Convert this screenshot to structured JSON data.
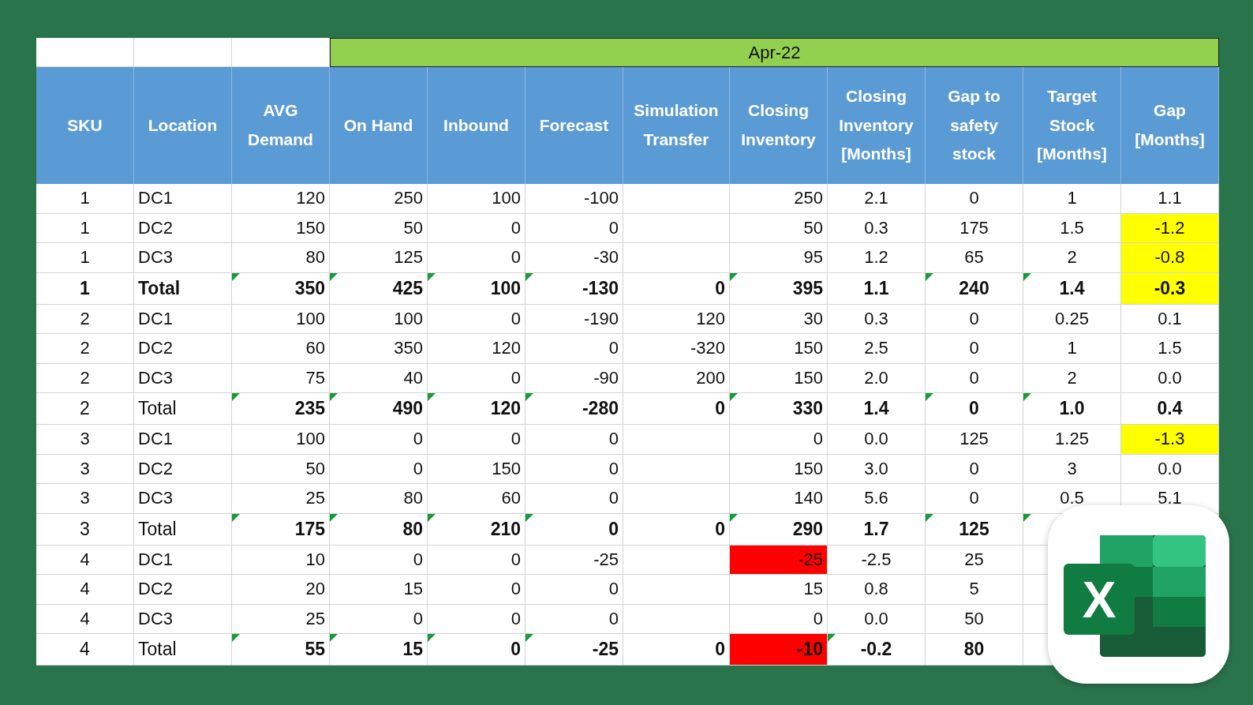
{
  "period": {
    "label": "Apr-22"
  },
  "columns": [
    "SKU",
    "Location",
    "AVG Demand",
    "On Hand",
    "Inbound",
    "Forecast",
    "Simulation Transfer",
    "Closing Inventory",
    "Closing Inventory [Months]",
    "Gap to safety stock",
    "Target Stock [Months]",
    "Gap [Months]"
  ],
  "rows": [
    {
      "kind": "detail",
      "label_bold": false,
      "cells": [
        {
          "text": "1"
        },
        {
          "text": "DC1"
        },
        {
          "text": "120"
        },
        {
          "text": "250"
        },
        {
          "text": "100"
        },
        {
          "text": "-100"
        },
        {},
        {
          "text": "250"
        },
        {
          "text": "2.1"
        },
        {
          "text": "0"
        },
        {
          "text": "1"
        },
        {
          "text": "1.1"
        }
      ]
    },
    {
      "kind": "detail",
      "label_bold": false,
      "cells": [
        {
          "text": "1"
        },
        {
          "text": "DC2"
        },
        {
          "text": "150"
        },
        {
          "text": "50"
        },
        {
          "text": "0"
        },
        {
          "text": "0"
        },
        {},
        {
          "text": "50"
        },
        {
          "text": "0.3"
        },
        {
          "text": "175"
        },
        {
          "text": "1.5"
        },
        {
          "text": "-1.2",
          "color": "#ffff00"
        }
      ]
    },
    {
      "kind": "detail",
      "label_bold": false,
      "cells": [
        {
          "text": "1"
        },
        {
          "text": "DC3"
        },
        {
          "text": "80"
        },
        {
          "text": "125"
        },
        {
          "text": "0"
        },
        {
          "text": "-30"
        },
        {},
        {
          "text": "95"
        },
        {
          "text": "1.2"
        },
        {
          "text": "65"
        },
        {
          "text": "2"
        },
        {
          "text": "-0.8",
          "color": "#ffff00"
        }
      ]
    },
    {
      "kind": "total",
      "label_bold": true,
      "cells": [
        {
          "text": "1",
          "flag": false
        },
        {
          "text": "Total",
          "flag": false
        },
        {
          "text": "350",
          "flag": true
        },
        {
          "text": "425",
          "flag": true
        },
        {
          "text": "100",
          "flag": true
        },
        {
          "text": "-130",
          "flag": true
        },
        {
          "text": "0",
          "flag": false
        },
        {
          "text": "395",
          "flag": true
        },
        {
          "text": "1.1",
          "flag": false
        },
        {
          "text": "240",
          "flag": true
        },
        {
          "text": "1.4",
          "flag": true
        },
        {
          "text": "-0.3",
          "flag": false,
          "color": "#ffff00"
        }
      ]
    },
    {
      "kind": "detail",
      "label_bold": false,
      "cells": [
        {
          "text": "2"
        },
        {
          "text": "DC1"
        },
        {
          "text": "100"
        },
        {
          "text": "100"
        },
        {
          "text": "0"
        },
        {
          "text": "-190"
        },
        {
          "text": "120"
        },
        {
          "text": "30"
        },
        {
          "text": "0.3"
        },
        {
          "text": "0"
        },
        {
          "text": "0.25"
        },
        {
          "text": "0.1"
        }
      ]
    },
    {
      "kind": "detail",
      "label_bold": false,
      "cells": [
        {
          "text": "2"
        },
        {
          "text": "DC2"
        },
        {
          "text": "60"
        },
        {
          "text": "350"
        },
        {
          "text": "120"
        },
        {
          "text": "0"
        },
        {
          "text": "-320"
        },
        {
          "text": "150"
        },
        {
          "text": "2.5"
        },
        {
          "text": "0"
        },
        {
          "text": "1"
        },
        {
          "text": "1.5"
        }
      ]
    },
    {
      "kind": "detail",
      "label_bold": false,
      "cells": [
        {
          "text": "2"
        },
        {
          "text": "DC3"
        },
        {
          "text": "75"
        },
        {
          "text": "40"
        },
        {
          "text": "0"
        },
        {
          "text": "-90"
        },
        {
          "text": "200"
        },
        {
          "text": "150"
        },
        {
          "text": "2.0"
        },
        {
          "text": "0"
        },
        {
          "text": "2"
        },
        {
          "text": "0.0"
        }
      ]
    },
    {
      "kind": "total",
      "label_bold": false,
      "cells": [
        {
          "text": "2",
          "flag": false
        },
        {
          "text": "Total",
          "flag": false
        },
        {
          "text": "235",
          "flag": true
        },
        {
          "text": "490",
          "flag": true
        },
        {
          "text": "120",
          "flag": true
        },
        {
          "text": "-280",
          "flag": true
        },
        {
          "text": "0",
          "flag": false
        },
        {
          "text": "330",
          "flag": true
        },
        {
          "text": "1.4",
          "flag": false
        },
        {
          "text": "0",
          "flag": true
        },
        {
          "text": "1.0",
          "flag": true
        },
        {
          "text": "0.4",
          "flag": false
        }
      ]
    },
    {
      "kind": "detail",
      "label_bold": false,
      "cells": [
        {
          "text": "3"
        },
        {
          "text": "DC1"
        },
        {
          "text": "100"
        },
        {
          "text": "0"
        },
        {
          "text": "0"
        },
        {
          "text": "0"
        },
        {},
        {
          "text": "0"
        },
        {
          "text": "0.0"
        },
        {
          "text": "125"
        },
        {
          "text": "1.25"
        },
        {
          "text": "-1.3",
          "color": "#ffff00"
        }
      ]
    },
    {
      "kind": "detail",
      "label_bold": false,
      "cells": [
        {
          "text": "3"
        },
        {
          "text": "DC2"
        },
        {
          "text": "50"
        },
        {
          "text": "0"
        },
        {
          "text": "150"
        },
        {
          "text": "0"
        },
        {},
        {
          "text": "150"
        },
        {
          "text": "3.0"
        },
        {
          "text": "0"
        },
        {
          "text": "3"
        },
        {
          "text": "0.0"
        }
      ]
    },
    {
      "kind": "detail",
      "label_bold": false,
      "cells": [
        {
          "text": "3"
        },
        {
          "text": "DC3"
        },
        {
          "text": "25"
        },
        {
          "text": "80"
        },
        {
          "text": "60"
        },
        {
          "text": "0"
        },
        {},
        {
          "text": "140"
        },
        {
          "text": "5.6"
        },
        {
          "text": "0"
        },
        {
          "text": "0.5"
        },
        {
          "text": "5.1"
        }
      ]
    },
    {
      "kind": "total",
      "label_bold": false,
      "cells": [
        {
          "text": "3",
          "flag": false
        },
        {
          "text": "Total",
          "flag": false
        },
        {
          "text": "175",
          "flag": true
        },
        {
          "text": "80",
          "flag": true
        },
        {
          "text": "210",
          "flag": true
        },
        {
          "text": "0",
          "flag": true
        },
        {
          "text": "0",
          "flag": false
        },
        {
          "text": "290",
          "flag": true
        },
        {
          "text": "1.7",
          "flag": false
        },
        {
          "text": "125",
          "flag": true
        },
        {
          "flag": true
        }
      ]
    },
    {
      "kind": "detail",
      "label_bold": false,
      "cells": [
        {
          "text": "4"
        },
        {
          "text": "DC1"
        },
        {
          "text": "10"
        },
        {
          "text": "0"
        },
        {
          "text": "0"
        },
        {
          "text": "-25"
        },
        {},
        {
          "text": "-25",
          "color": "#ff0000"
        },
        {
          "text": "-2.5"
        },
        {
          "text": "25"
        }
      ]
    },
    {
      "kind": "detail",
      "label_bold": false,
      "cells": [
        {
          "text": "4"
        },
        {
          "text": "DC2"
        },
        {
          "text": "20"
        },
        {
          "text": "15"
        },
        {
          "text": "0"
        },
        {
          "text": "0"
        },
        {},
        {
          "text": "15"
        },
        {
          "text": "0.8"
        },
        {
          "text": "5"
        }
      ]
    },
    {
      "kind": "detail",
      "label_bold": false,
      "cells": [
        {
          "text": "4"
        },
        {
          "text": "DC3"
        },
        {
          "text": "25"
        },
        {
          "text": "0"
        },
        {
          "text": "0"
        },
        {
          "text": "0"
        },
        {},
        {
          "text": "0"
        },
        {
          "text": "0.0"
        },
        {
          "text": "50"
        }
      ]
    },
    {
      "kind": "total",
      "label_bold": false,
      "cells": [
        {
          "text": "4",
          "flag": false
        },
        {
          "text": "Total",
          "flag": false
        },
        {
          "text": "55",
          "flag": true
        },
        {
          "text": "15",
          "flag": true
        },
        {
          "text": "0",
          "flag": true
        },
        {
          "text": "-25",
          "flag": true
        },
        {
          "text": "0",
          "flag": false
        },
        {
          "text": "-10",
          "flag": false,
          "color": "#ff0000"
        },
        {
          "text": "-0.2",
          "flag": true
        },
        {
          "text": "80",
          "flag": false
        }
      ]
    }
  ],
  "app_icon": {
    "letter": "X"
  }
}
